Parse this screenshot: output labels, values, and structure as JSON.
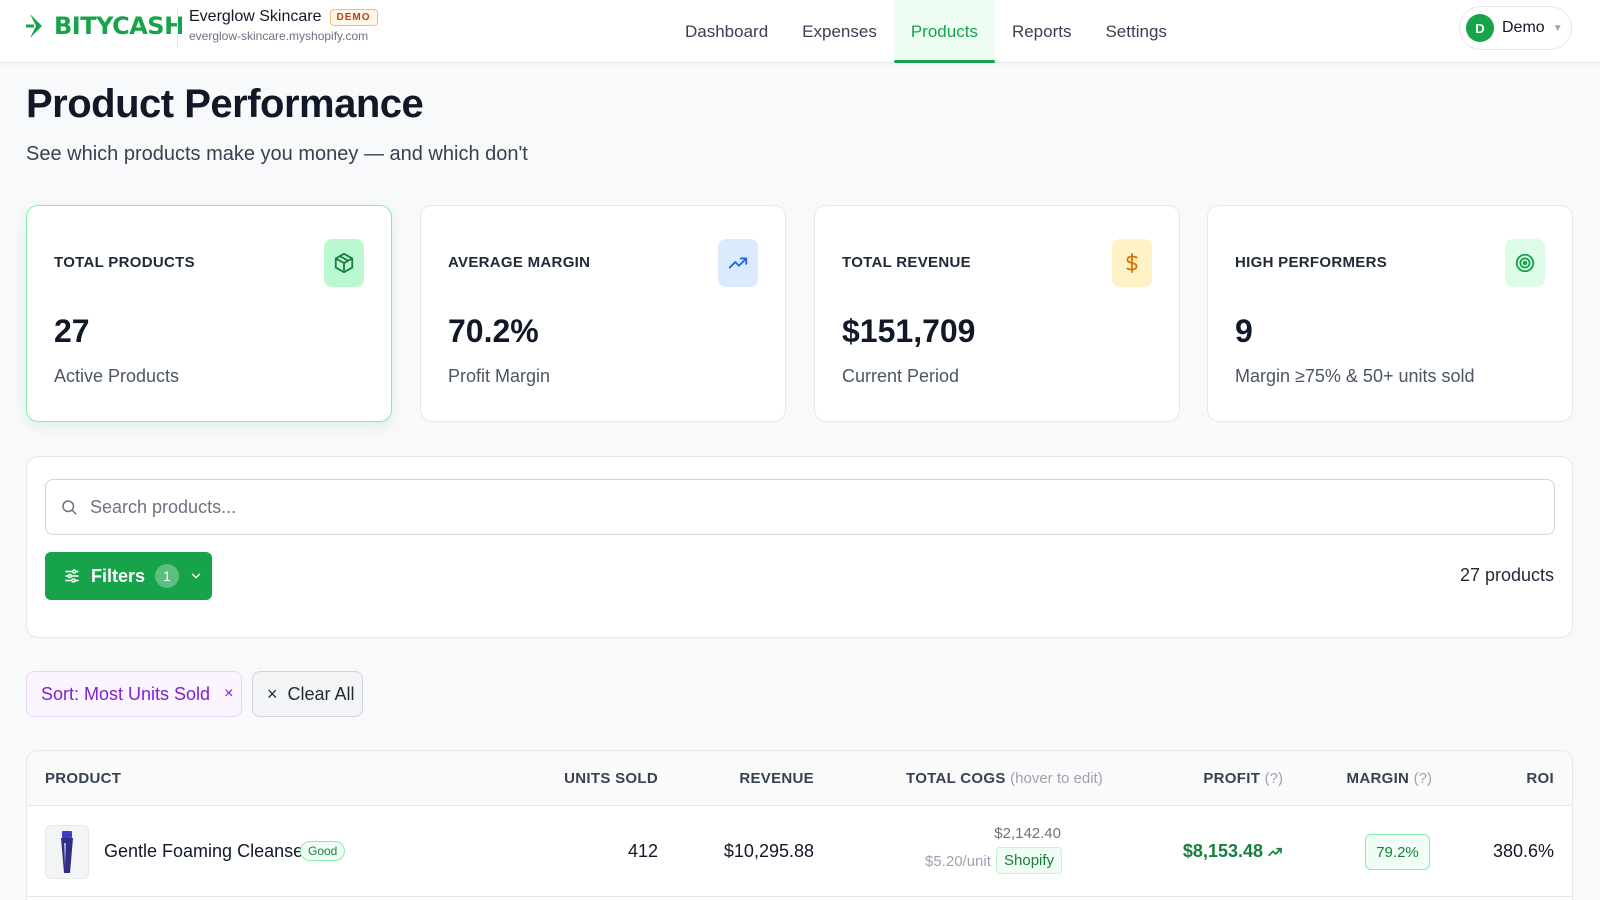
{
  "brand": {
    "logo_text": "BITYCASH"
  },
  "store": {
    "name": "Everglow Skincare",
    "badge": "DEMO",
    "url": "everglow-skincare.myshopify.com"
  },
  "nav": {
    "items": [
      "Dashboard",
      "Expenses",
      "Products",
      "Reports",
      "Settings"
    ],
    "active": "Products"
  },
  "user": {
    "initial": "D",
    "name": "Demo"
  },
  "header": {
    "title": "Product Performance",
    "subtitle": "See which products make you money — and which don't"
  },
  "stats": [
    {
      "label": "TOTAL PRODUCTS",
      "value": "27",
      "sub": "Active Products",
      "icon": "box-icon",
      "color": "#16a34a"
    },
    {
      "label": "AVERAGE MARGIN",
      "value": "70.2%",
      "sub": "Profit Margin",
      "icon": "trending-up-icon",
      "color": "#2563eb"
    },
    {
      "label": "TOTAL REVENUE",
      "value": "$151,709",
      "sub": "Current Period",
      "icon": "dollar-icon",
      "color": "#d97706"
    },
    {
      "label": "HIGH PERFORMERS",
      "value": "9",
      "sub": "Margin ≥75% & 50+ units sold",
      "icon": "target-icon",
      "color": "#16a34a"
    }
  ],
  "search": {
    "placeholder": "Search products..."
  },
  "filters": {
    "label": "Filters",
    "count": "1",
    "product_count": "27 products"
  },
  "chips": {
    "sort": "Sort: Most Units Sold",
    "clear": "Clear All"
  },
  "table": {
    "headers": {
      "product": "PRODUCT",
      "units": "UNITS SOLD",
      "revenue": "REVENUE",
      "cogs": "TOTAL COGS",
      "cogs_hint": "(hover to edit)",
      "profit": "PROFIT",
      "profit_hint": "(?)",
      "margin": "MARGIN",
      "margin_hint": "(?)",
      "roi": "ROI"
    },
    "rows": [
      {
        "name": "Gentle Foaming Cleanser",
        "badge": "Good",
        "units": "412",
        "revenue": "$10,295.88",
        "cogs_total": "$2,142.40",
        "cogs_unit": "$5.20/unit",
        "cogs_source": "Shopify",
        "profit": "$8,153.48",
        "margin": "79.2%",
        "roi": "380.6%"
      }
    ]
  }
}
